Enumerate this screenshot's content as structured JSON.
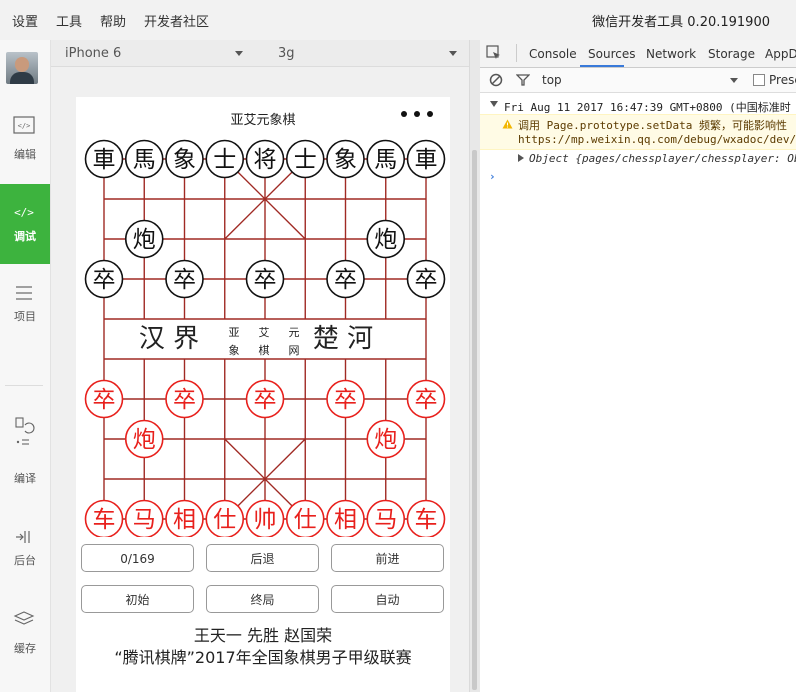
{
  "menu": {
    "items": [
      "设置",
      "工具",
      "帮助",
      "开发者社区"
    ],
    "app_title": "微信开发者工具 0.20.191900"
  },
  "sidebar": {
    "items": [
      {
        "label": "编辑",
        "icon": "code-icon"
      },
      {
        "label": "调试",
        "icon": "debug-icon"
      },
      {
        "label": "项目",
        "icon": "menu-icon"
      },
      {
        "label": "编译",
        "icon": "compile-icon"
      },
      {
        "label": "后台",
        "icon": "background-icon"
      },
      {
        "label": "缓存",
        "icon": "layers-icon"
      }
    ]
  },
  "simulator": {
    "device": "iPhone 6",
    "network": "3g"
  },
  "app": {
    "title": "亚艾元象棋",
    "river": {
      "left": "汉 界",
      "right": "楚 河",
      "mid_top": [
        "亚",
        "艾",
        "元"
      ],
      "mid_bottom": [
        "象",
        "棋",
        "网"
      ]
    },
    "buttons": {
      "counter": "0/169",
      "back": "后退",
      "forward": "前进",
      "start": "初始",
      "end": "终局",
      "auto": "自动"
    },
    "result_line1": "王天一  先胜  赵国荣",
    "result_line2": "“腾讯棋牌”2017年全国象棋男子甲级联赛"
  },
  "pieces": {
    "black_back": [
      "車",
      "馬",
      "象",
      "士",
      "将",
      "士",
      "象",
      "馬",
      "車"
    ],
    "black_cannon": "炮",
    "black_soldier": "卒",
    "red_back": [
      "车",
      "马",
      "相",
      "仕",
      "帅",
      "仕",
      "相",
      "马",
      "车"
    ],
    "red_cannon": "炮",
    "red_soldier": "卒",
    "colors": {
      "red": "#e8201c",
      "black": "#111111",
      "board_line": "#a02a24"
    }
  },
  "devtools": {
    "tabs": [
      "Console",
      "Sources",
      "Network",
      "Storage",
      "AppD"
    ],
    "active_tab": "Sources",
    "filter_context": "top",
    "preserve_label": "Prese",
    "log": {
      "date_line": "Fri Aug 11 2017 16:47:39 GMT+0800 (中国标准时",
      "warn_line": "调用 Page.prototype.setData 频繁，可能影响性",
      "url_line": "https://mp.weixin.qq.com/debug/wxadoc/dev/",
      "object_line": "Object {pages/chessplayer/chessplayer: Ob"
    }
  }
}
